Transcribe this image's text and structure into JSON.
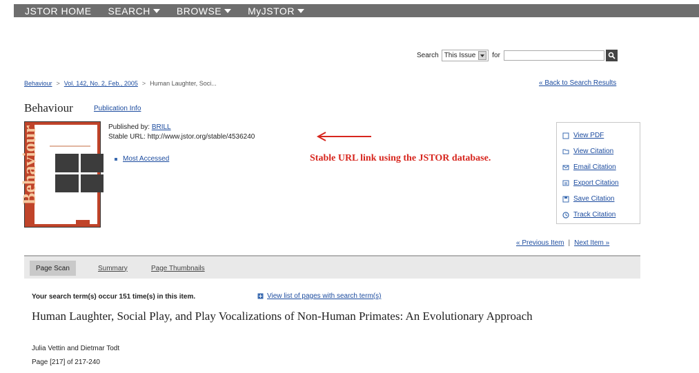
{
  "nav": {
    "home": "JSTOR HOME",
    "search": "SEARCH",
    "browse": "BROWSE",
    "myjstor": "MyJSTOR"
  },
  "search": {
    "label": "Search",
    "scope": "This Issue",
    "for_label": "for",
    "value": ""
  },
  "breadcrumb": {
    "journal": "Behaviour",
    "issue": "Vol. 142, No. 2, Feb., 2005",
    "article": "Human Laughter, Soci..."
  },
  "back_link": "« Back to Search Results",
  "journal": {
    "title": "Behaviour",
    "pub_info": "Publication Info",
    "cover_text": "Behaviour"
  },
  "meta": {
    "published_by_label": "Published by:",
    "publisher": "BRILL",
    "stable_url_label": "Stable URL:",
    "stable_url": "http://www.jstor.org/stable/4536240",
    "most_accessed": "Most Accessed"
  },
  "annotation": {
    "text": "Stable URL link using the JSTOR database.",
    "color": "#d7261e"
  },
  "tools": [
    {
      "label": "View PDF",
      "icon": "pdf-icon"
    },
    {
      "label": "View Citation",
      "icon": "folder-icon"
    },
    {
      "label": "Email Citation",
      "icon": "email-icon"
    },
    {
      "label": "Export Citation",
      "icon": "export-icon"
    },
    {
      "label": "Save Citation",
      "icon": "save-icon"
    },
    {
      "label": "Track Citation",
      "icon": "clock-icon"
    }
  ],
  "prevnext": {
    "prev": "« Previous Item",
    "next": "Next Item »"
  },
  "tabs": [
    {
      "label": "Page Scan",
      "active": true
    },
    {
      "label": "Summary",
      "active": false
    },
    {
      "label": "Page Thumbnails",
      "active": false
    }
  ],
  "hits": {
    "text": "Your search term(s) occur 151 time(s) in this item.",
    "link": "View list of pages with search term(s)"
  },
  "article": {
    "title": "Human Laughter, Social Play, and Play Vocalizations of Non-Human Primates: An Evolutionary Approach",
    "authors": "Julia Vettin and Dietmar Todt",
    "pages": "Page [217] of 217-240"
  }
}
